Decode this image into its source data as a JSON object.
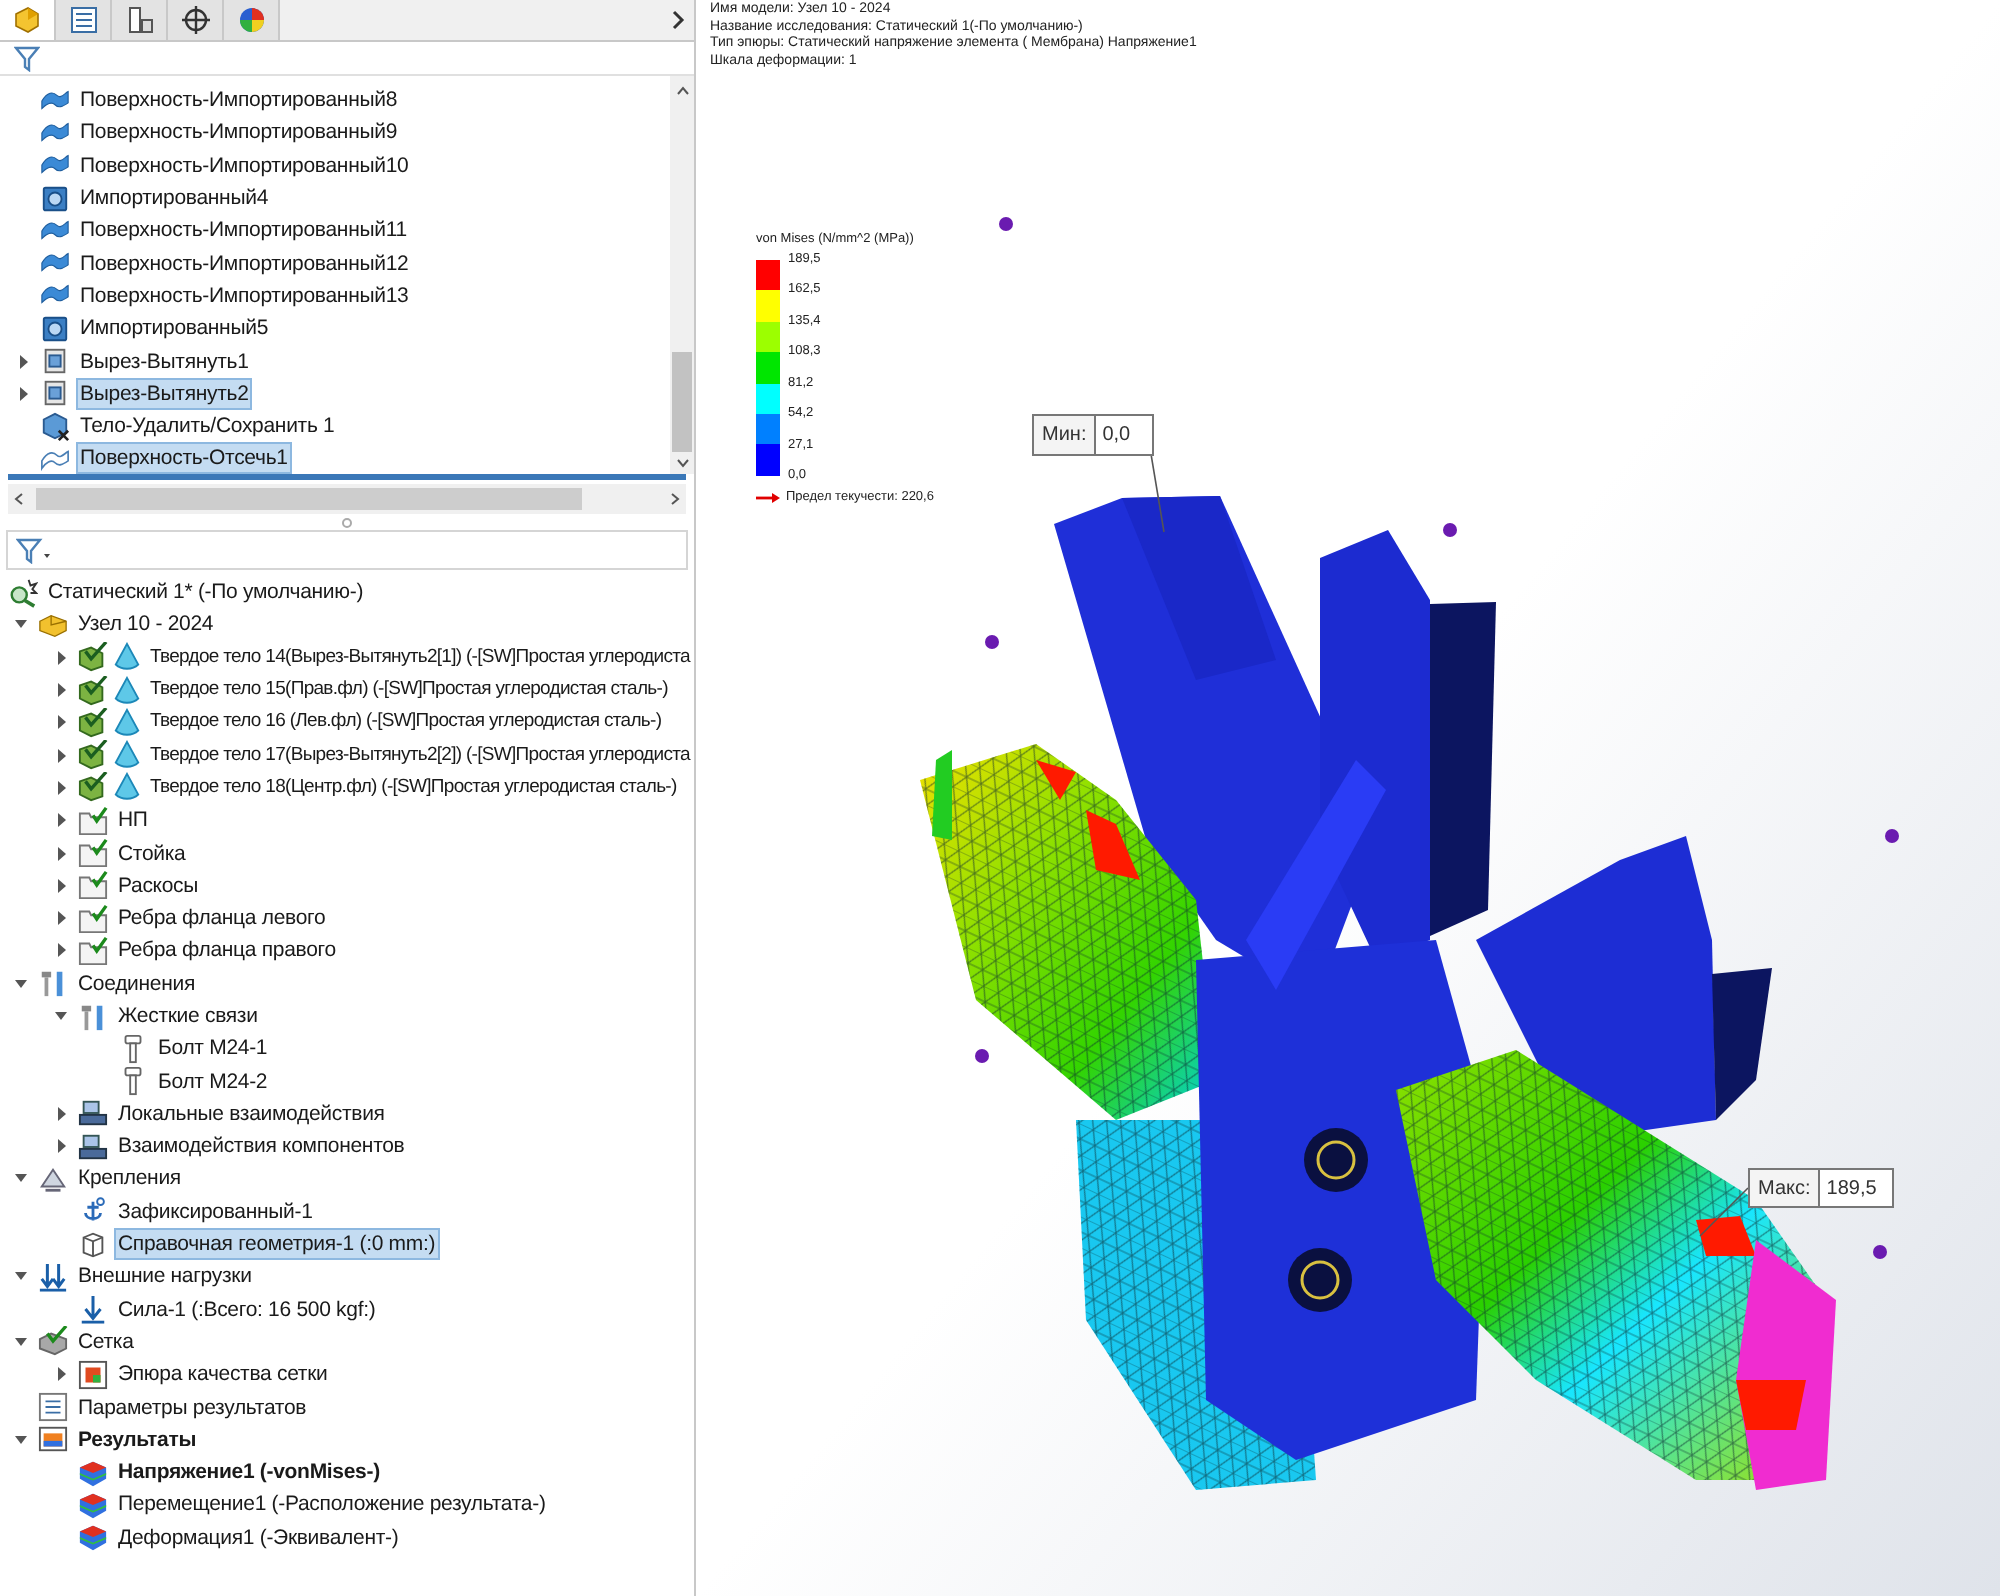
{
  "panel_tabs": [
    {
      "selected": true
    },
    {
      "selected": false
    },
    {
      "selected": false
    },
    {
      "selected": false
    },
    {
      "selected": false
    }
  ],
  "feature_tree": {
    "items": [
      {
        "label": "Поверхность-Импортированный8",
        "kind": "surface",
        "selected": false
      },
      {
        "label": "Поверхность-Импортированный9",
        "kind": "surface",
        "selected": false
      },
      {
        "label": "Поверхность-Импортированный10",
        "kind": "surface",
        "selected": false
      },
      {
        "label": "Импортированный4",
        "kind": "imported",
        "selected": false
      },
      {
        "label": "Поверхность-Импортированный11",
        "kind": "surface",
        "selected": false
      },
      {
        "label": "Поверхность-Импортированный12",
        "kind": "surface",
        "selected": false
      },
      {
        "label": "Поверхность-Импортированный13",
        "kind": "surface",
        "selected": false
      },
      {
        "label": "Импортированный5",
        "kind": "imported",
        "selected": false
      },
      {
        "label": "Вырез-Вытянуть1",
        "kind": "cut",
        "expanded": false,
        "selected": false
      },
      {
        "label": "Вырез-Вытянуть2",
        "kind": "cut",
        "expanded": false,
        "selected": true
      },
      {
        "label": "Тело-Удалить/Сохранить 1",
        "kind": "body-delete",
        "selected": false
      },
      {
        "label": "Поверхность-Отсечь1",
        "kind": "surface-cut",
        "selected": true
      }
    ]
  },
  "study_tree": {
    "items": [
      {
        "label": "Статический 1* (-По умолчанию-)",
        "kind": "study",
        "selected": false,
        "children": [
          {
            "label": "Узел 10 - 2024",
            "kind": "assembly",
            "expanded": true,
            "selected": false,
            "children": [
              {
                "label": "Твердое тело 14(Вырез-Вытянуть2[1]) (-[SW]Простая углеродиста",
                "kind": "solid-body",
                "expanded": false,
                "selected": false
              },
              {
                "label": "Твердое тело 15(Прав.фл) (-[SW]Простая углеродистая сталь-)",
                "kind": "solid-body",
                "expanded": false,
                "selected": false
              },
              {
                "label": "Твердое тело 16 (Лев.фл) (-[SW]Простая углеродистая сталь-)",
                "kind": "solid-body",
                "expanded": false,
                "selected": false
              },
              {
                "label": "Твердое тело 17(Вырез-Вытянуть2[2]) (-[SW]Простая углеродиста",
                "kind": "solid-body",
                "expanded": false,
                "selected": false
              },
              {
                "label": "Твердое тело 18(Центр.фл) (-[SW]Простая углеродистая сталь-)",
                "kind": "solid-body",
                "expanded": false,
                "selected": false
              },
              {
                "label": "НП",
                "kind": "folder",
                "expanded": false,
                "selected": false
              },
              {
                "label": "Стойка",
                "kind": "folder",
                "expanded": false,
                "selected": false
              },
              {
                "label": "Раскосы",
                "kind": "folder",
                "expanded": false,
                "selected": false
              },
              {
                "label": "Ребра фланца левого",
                "kind": "folder",
                "expanded": false,
                "selected": false
              },
              {
                "label": "Ребра фланца правого",
                "kind": "folder",
                "expanded": false,
                "selected": false
              }
            ]
          },
          {
            "label": "Соединения",
            "kind": "connections",
            "expanded": true,
            "selected": false,
            "children": [
              {
                "label": "Жесткие связи",
                "kind": "connections",
                "expanded": true,
                "selected": false,
                "children": [
                  {
                    "label": "Болт М24-1",
                    "kind": "bolt",
                    "selected": false
                  },
                  {
                    "label": "Болт М24-2",
                    "kind": "bolt",
                    "selected": false
                  }
                ]
              },
              {
                "label": "Локальные взаимодействия",
                "kind": "interaction",
                "expanded": false,
                "selected": false
              },
              {
                "label": "Взаимодействия компонентов",
                "kind": "interaction",
                "expanded": false,
                "selected": false
              }
            ]
          },
          {
            "label": "Крепления",
            "kind": "fixtures",
            "expanded": true,
            "selected": false,
            "children": [
              {
                "label": "Зафиксированный-1",
                "kind": "anchor",
                "selected": false
              },
              {
                "label": "Справочная геометрия-1 (:0 mm:)",
                "kind": "ref-geometry",
                "selected": true
              }
            ]
          },
          {
            "label": "Внешние нагрузки",
            "kind": "loads",
            "expanded": true,
            "selected": false,
            "children": [
              {
                "label": "Сила-1 (:Всего: 16 500 kgf:)",
                "kind": "force",
                "selected": false
              }
            ]
          },
          {
            "label": "Сетка",
            "kind": "mesh",
            "expanded": true,
            "selected": false,
            "children": [
              {
                "label": "Эпюра качества сетки",
                "kind": "plot",
                "expanded": false,
                "selected": false
              }
            ]
          },
          {
            "label": "Параметры результатов",
            "kind": "list",
            "selected": false
          },
          {
            "label": "Результаты",
            "kind": "results",
            "expanded": true,
            "selected": false,
            "bold": true,
            "children": [
              {
                "label": "Напряжение1 (-vonMises-)",
                "kind": "result",
                "selected": false,
                "bold": true
              },
              {
                "label": "Перемещение1 (-Расположение результата-)",
                "kind": "result",
                "selected": false,
                "bold": false
              },
              {
                "label": "Деформация1 (-Эквивалент-)",
                "kind": "result",
                "selected": false,
                "bold": false
              }
            ]
          }
        ]
      }
    ]
  },
  "viewport": {
    "info_lines": [
      "Имя модели: Узел 10 - 2024",
      "Название исследования: Статический 1(-По умолчанию-)",
      "Тип эпюры: Статический напряжение элемента ( Мембрана) Напряжение1",
      "Шкала деформации: 1"
    ],
    "legend": {
      "title": "von Mises (N/mm^2 (MPa))",
      "ticks": [
        "189,5",
        "162,5",
        "135,4",
        "108,3",
        "81,2",
        "54,2",
        "27,1",
        "0,0"
      ],
      "bands": [
        {
          "color": "#ff0000"
        },
        {
          "color": "#ffff00"
        },
        {
          "color": "#9cff00"
        },
        {
          "color": "#00e600"
        },
        {
          "color": "#00ffff"
        },
        {
          "color": "#0080ff"
        },
        {
          "color": "#0000ff"
        }
      ],
      "yield_label": "Предел текучести: 220,6"
    },
    "min_callout": {
      "label": "Мин:",
      "value": "0,0"
    },
    "max_callout": {
      "label": "Макс:",
      "value": "189,5"
    }
  }
}
